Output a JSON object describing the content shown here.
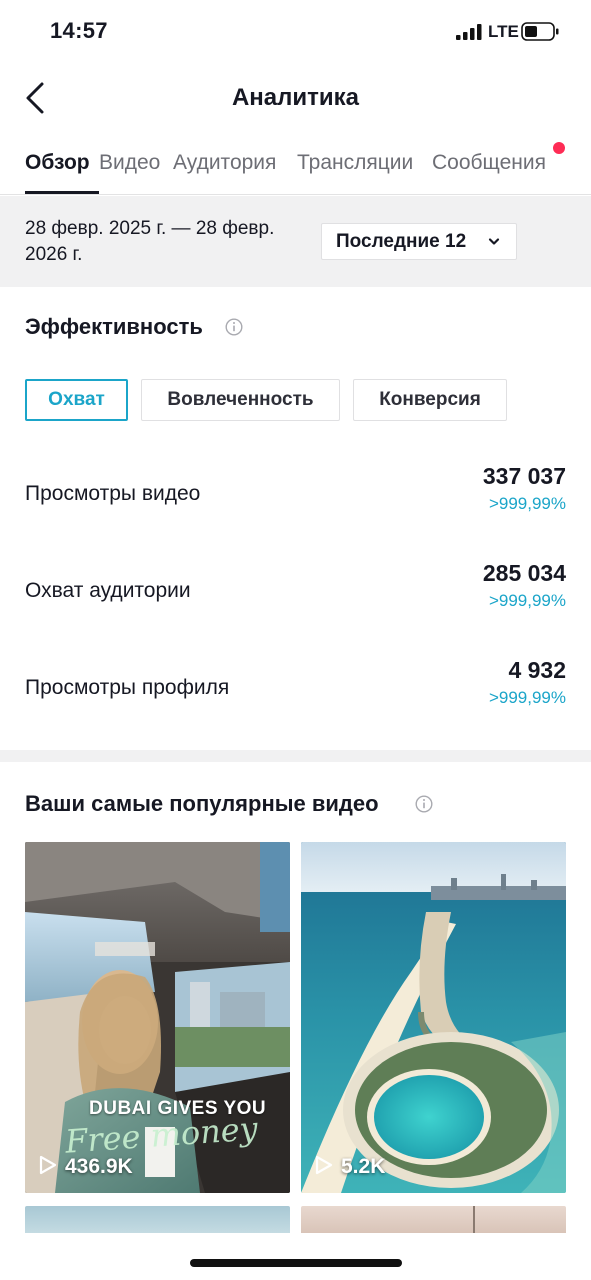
{
  "status_bar": {
    "time": "14:57",
    "network": "LTE",
    "icons": [
      "signal-icon",
      "battery-icon"
    ]
  },
  "header": {
    "title": "Аналитика",
    "back_icon": "chevron-left-icon"
  },
  "tabs": [
    {
      "label": "Обзор",
      "active": true
    },
    {
      "label": "Видео",
      "active": false
    },
    {
      "label": "Аудитория",
      "active": false
    },
    {
      "label": "Трансляции",
      "active": false
    },
    {
      "label": "Сообщения",
      "active": false
    }
  ],
  "date_bar": {
    "range_line1": "28 февр. 2025 г. — 28 февр.",
    "range_line2": "2026 г.",
    "period_selected": "Последние 12"
  },
  "performance": {
    "title": "Эффективность",
    "metric_tabs": [
      {
        "label": "Охват",
        "active": true
      },
      {
        "label": "Вовлеченность",
        "active": false
      },
      {
        "label": "Конверсия",
        "active": false
      }
    ],
    "stats": [
      {
        "label": "Просмотры видео",
        "value": "337 037",
        "change": ">999,99%"
      },
      {
        "label": "Охват аудитории",
        "value": "285 034",
        "change": ">999,99%"
      },
      {
        "label": "Просмотры профиля",
        "value": "4 932",
        "change": ">999,99%"
      }
    ]
  },
  "top_videos": {
    "title": "Ваши самые популярные видео",
    "videos": [
      {
        "views": "436.9K",
        "overlay_text": "DUBAI GIVES YOU",
        "overlay_script": "Free money"
      },
      {
        "views": "5.2K"
      }
    ]
  },
  "colors": {
    "accent": "#1ba5c9",
    "text": "#161823",
    "secondary_text": "#6d6e75",
    "notification": "#fe2c55",
    "panel_bg": "#f1f1f2"
  }
}
